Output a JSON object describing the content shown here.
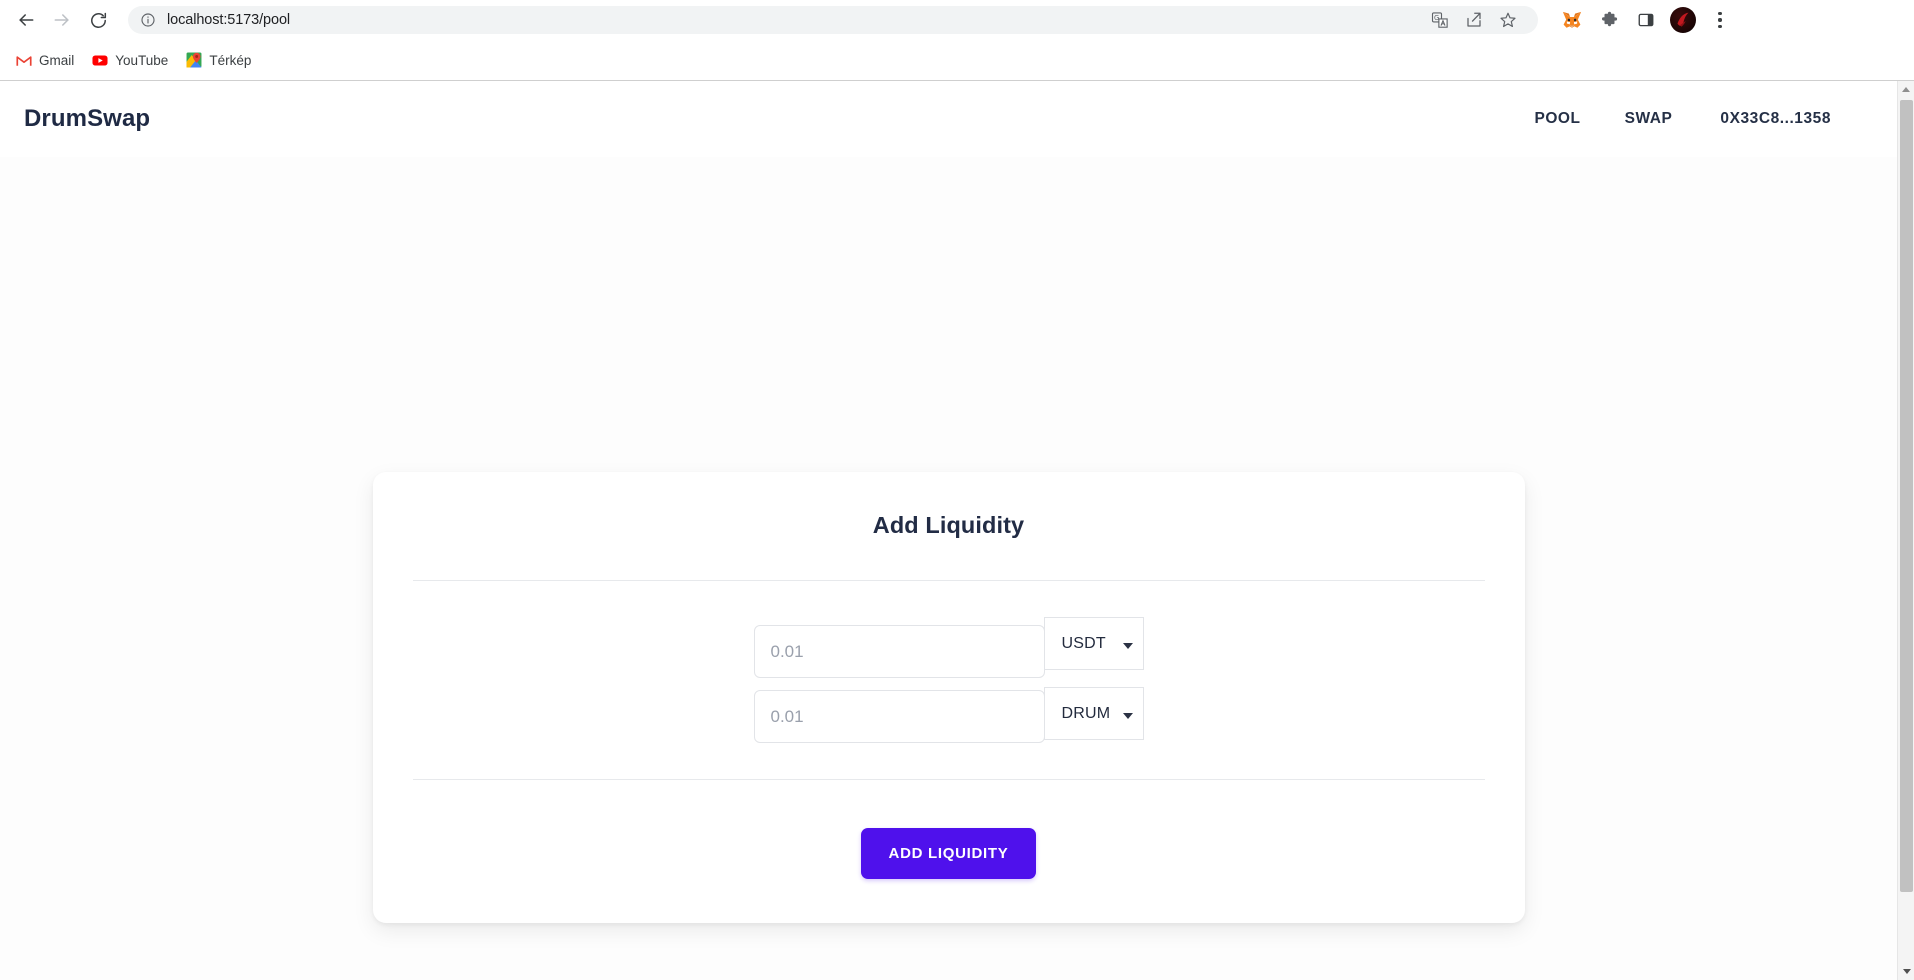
{
  "browser": {
    "back_icon": "arrow-left-icon",
    "forward_icon": "arrow-right-icon",
    "reload_icon": "reload-icon",
    "site_info_icon": "info-circle-icon",
    "url": "localhost:5173/pool",
    "omnibox_actions": [
      {
        "name": "translate-icon",
        "title": "Translate this page"
      },
      {
        "name": "share-icon",
        "title": "Share this page"
      },
      {
        "name": "bookmark-star-icon",
        "title": "Bookmark this tab"
      }
    ],
    "extensions": [
      {
        "name": "metamask-extension-icon",
        "title": "MetaMask"
      },
      {
        "name": "extensions-puzzle-icon",
        "title": "Extensions"
      },
      {
        "name": "side-panel-icon",
        "title": "Side panel"
      }
    ],
    "profile_icon": "profile-avatar",
    "menu_icon": "three-dot-menu-icon",
    "bookmarks": [
      {
        "label": "Gmail",
        "icon": "gmail-icon"
      },
      {
        "label": "YouTube",
        "icon": "youtube-icon"
      },
      {
        "label": "Térkép",
        "icon": "google-maps-icon"
      }
    ]
  },
  "app": {
    "brand": "DrumSwap",
    "nav": [
      {
        "label": "POOL"
      },
      {
        "label": "SWAP"
      },
      {
        "label": "0X33C8...1358"
      }
    ],
    "card": {
      "title": "Add Liquidity",
      "fields": [
        {
          "placeholder": "0.01",
          "value": "",
          "token": "USDT",
          "caret_icon": "chevron-down-icon"
        },
        {
          "placeholder": "0.01",
          "value": "",
          "token": "DRUM",
          "caret_icon": "chevron-down-icon"
        }
      ],
      "submit_label": "ADD LIQUIDITY"
    }
  },
  "colors": {
    "accent": "#4F11EC",
    "brand_text": "#1F2A44",
    "placeholder": "#9AA0AC",
    "divider": "#E7E9EC",
    "field_border": "#E2E4E8"
  },
  "scrollbar": {
    "up_icon": "scroll-up-arrow-icon",
    "down_icon": "scroll-down-arrow-icon"
  }
}
